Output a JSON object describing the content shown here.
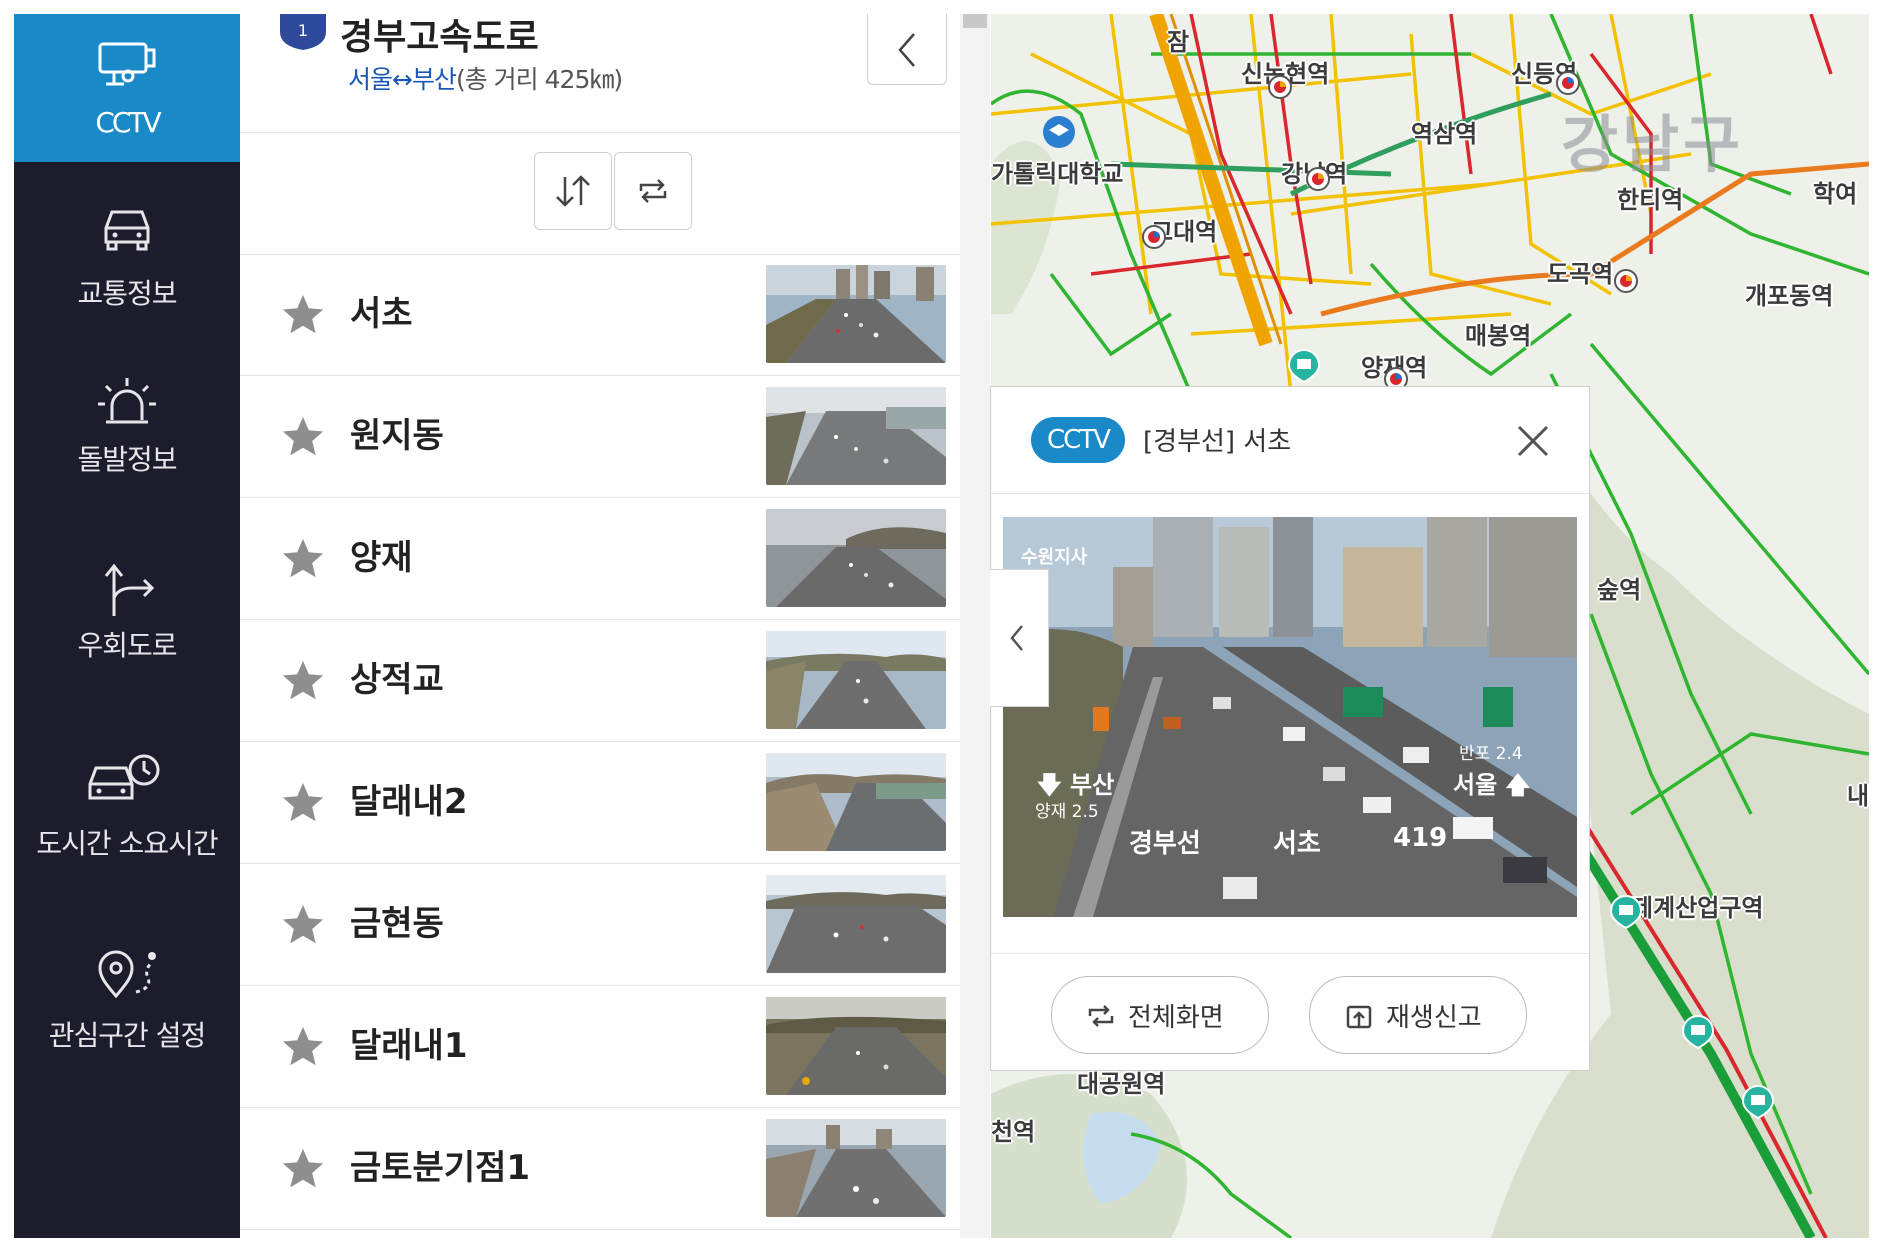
{
  "sidebar": {
    "items": [
      {
        "label": "CCTV",
        "active": true
      },
      {
        "label": "교통정보"
      },
      {
        "label": "돌발정보"
      },
      {
        "label": "우회도로"
      },
      {
        "label": "도시간 소요시간"
      },
      {
        "label": "관심구간 설정"
      }
    ]
  },
  "route": {
    "number": "1",
    "name": "경부고속도로",
    "from": "서울",
    "arrow": "↔",
    "to": "부산",
    "distance": "(총 거리 425㎞)"
  },
  "cctv_list": [
    {
      "name": "서초"
    },
    {
      "name": "원지동"
    },
    {
      "name": "양재"
    },
    {
      "name": "상적교"
    },
    {
      "name": "달래내2"
    },
    {
      "name": "금현동"
    },
    {
      "name": "달래내1"
    },
    {
      "name": "금토분기점1"
    }
  ],
  "map": {
    "district": "강남구",
    "stations": [
      "신논현역",
      "신등역",
      "역삼역",
      "강남역",
      "한티역",
      "고대역",
      "도곡역",
      "개포동역",
      "매봉역",
      "양재역",
      "가톨릭대학교",
      "숲역",
      "제계산업구역",
      "대공원역",
      "천역",
      "잠",
      "학여",
      "내"
    ]
  },
  "popup": {
    "badge": "CCTV",
    "title": "[경부선] 서초",
    "video_overlay": {
      "site": "수원지사",
      "left_dir": "부산",
      "left_next": "양재 2.5",
      "right_next": "반포 2.4",
      "right_dir": "서울",
      "road": "경부선",
      "location": "서초",
      "km": "419"
    },
    "buttons": {
      "fullscreen": "전체화면",
      "report": "재생신고"
    }
  },
  "colors": {
    "accent": "#1a89c8",
    "sidebar_bg": "#1d1c2d",
    "traffic_green": "#2fb52f",
    "traffic_yellow": "#f2c200",
    "traffic_red": "#d9272e",
    "highway_orange": "#f0a400"
  }
}
